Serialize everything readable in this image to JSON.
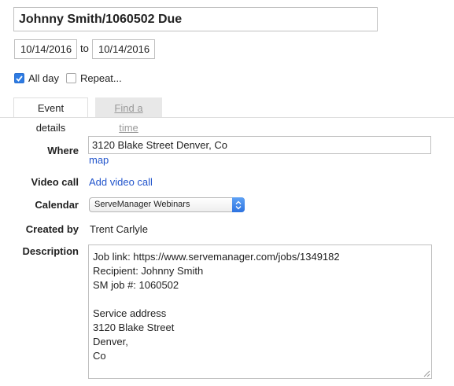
{
  "event": {
    "title": "Johnny Smith/1060502 Due",
    "start_date": "10/14/2016",
    "date_separator": "to",
    "end_date": "10/14/2016",
    "all_day": {
      "label": "All day",
      "checked": true
    },
    "repeat": {
      "label": "Repeat...",
      "checked": false
    }
  },
  "tabs": [
    {
      "label": "Event details",
      "active": true
    },
    {
      "label": "Find a time",
      "active": false
    }
  ],
  "details": {
    "where_label": "Where",
    "where_value": "3120 Blake Street Denver, Co",
    "map_link": "map",
    "video_label": "Video call",
    "video_link": "Add video call",
    "calendar_label": "Calendar",
    "calendar_value": "ServeManager Webinars",
    "created_by_label": "Created by",
    "created_by_value": "Trent Carlyle",
    "description_label": "Description",
    "description_lines": [
      "Job link: https://www.servemanager.com/jobs/1349182",
      "Recipient: Johnny Smith",
      "SM job #: 1060502",
      "",
      "Service address",
      "3120 Blake Street",
      "Denver,",
      "Co"
    ]
  },
  "colors": {
    "link": "#2255cc",
    "checkbox_checked": "#2d7be3",
    "select_arrow": "#2d73e0"
  }
}
